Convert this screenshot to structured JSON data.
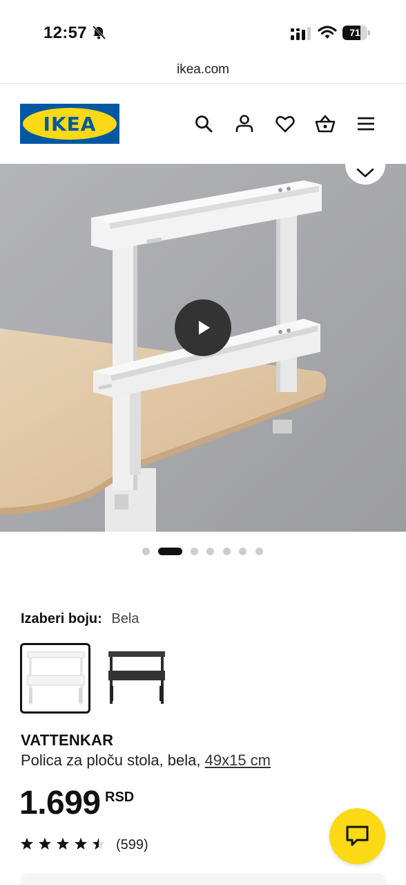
{
  "status_bar": {
    "time": "12:57",
    "battery_level": "71"
  },
  "browser": {
    "url": "ikea.com"
  },
  "header": {
    "logo_text": "IKEA",
    "brand_blue": "#0058a3",
    "brand_yellow": "#fbd914",
    "icons": [
      "search-icon",
      "account-icon",
      "heart-icon",
      "basket-icon",
      "menu-icon"
    ]
  },
  "gallery": {
    "image_count": 7,
    "active_index": 1,
    "play_icon": "play-icon",
    "favorite_icon": "chevron-down-icon"
  },
  "color_selector": {
    "label": "Izaberi boju:",
    "selected": "Bela",
    "options": [
      "white",
      "black"
    ]
  },
  "product": {
    "name": "VATTENKAR",
    "description": "Polica za ploču stola, bela,",
    "dimensions": "49x15 cm",
    "price": "1.699",
    "currency": "RSD",
    "rating": 4.5,
    "reviews": "(599)"
  },
  "chat": {
    "icon": "chat-icon"
  }
}
